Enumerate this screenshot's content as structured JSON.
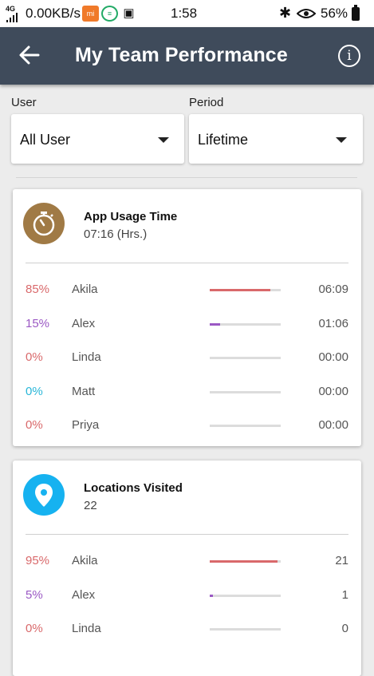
{
  "status_bar": {
    "network": "4G",
    "speed": "0.00KB/s",
    "notif_icons": [
      "mi-icon",
      "chat-icon",
      "image-icon"
    ],
    "time": "1:58",
    "battery": "56%"
  },
  "toolbar": {
    "title": "My Team Performance"
  },
  "filters": {
    "user_label": "User",
    "user_value": "All User",
    "period_label": "Period",
    "period_value": "Lifetime"
  },
  "cards": [
    {
      "title": "App Usage Time",
      "subtitle": "07:16 (Hrs.)",
      "icon": "stopwatch-icon",
      "icon_color": "#a07a45",
      "rows": [
        {
          "pct": "85%",
          "name": "Akila",
          "value": "06:09",
          "progress": 0.85,
          "color": "#d9696b"
        },
        {
          "pct": "15%",
          "name": "Alex",
          "value": "01:06",
          "progress": 0.15,
          "color": "#9b59c4"
        },
        {
          "pct": "0%",
          "name": "Linda",
          "value": "00:00",
          "progress": 0,
          "color": "#d9696b"
        },
        {
          "pct": "0%",
          "name": "Matt",
          "value": "00:00",
          "progress": 0,
          "color": "#29b6d8"
        },
        {
          "pct": "0%",
          "name": "Priya",
          "value": "00:00",
          "progress": 0,
          "color": "#d9696b"
        }
      ]
    },
    {
      "title": "Locations Visited",
      "subtitle": "22",
      "icon": "location-pin-icon",
      "icon_color": "#16b2f0",
      "rows": [
        {
          "pct": "95%",
          "name": "Akila",
          "value": "21",
          "progress": 0.95,
          "color": "#d9696b"
        },
        {
          "pct": "5%",
          "name": "Alex",
          "value": "1",
          "progress": 0.05,
          "color": "#9b59c4"
        },
        {
          "pct": "0%",
          "name": "Linda",
          "value": "0",
          "progress": 0,
          "color": "#d9696b"
        }
      ]
    }
  ]
}
